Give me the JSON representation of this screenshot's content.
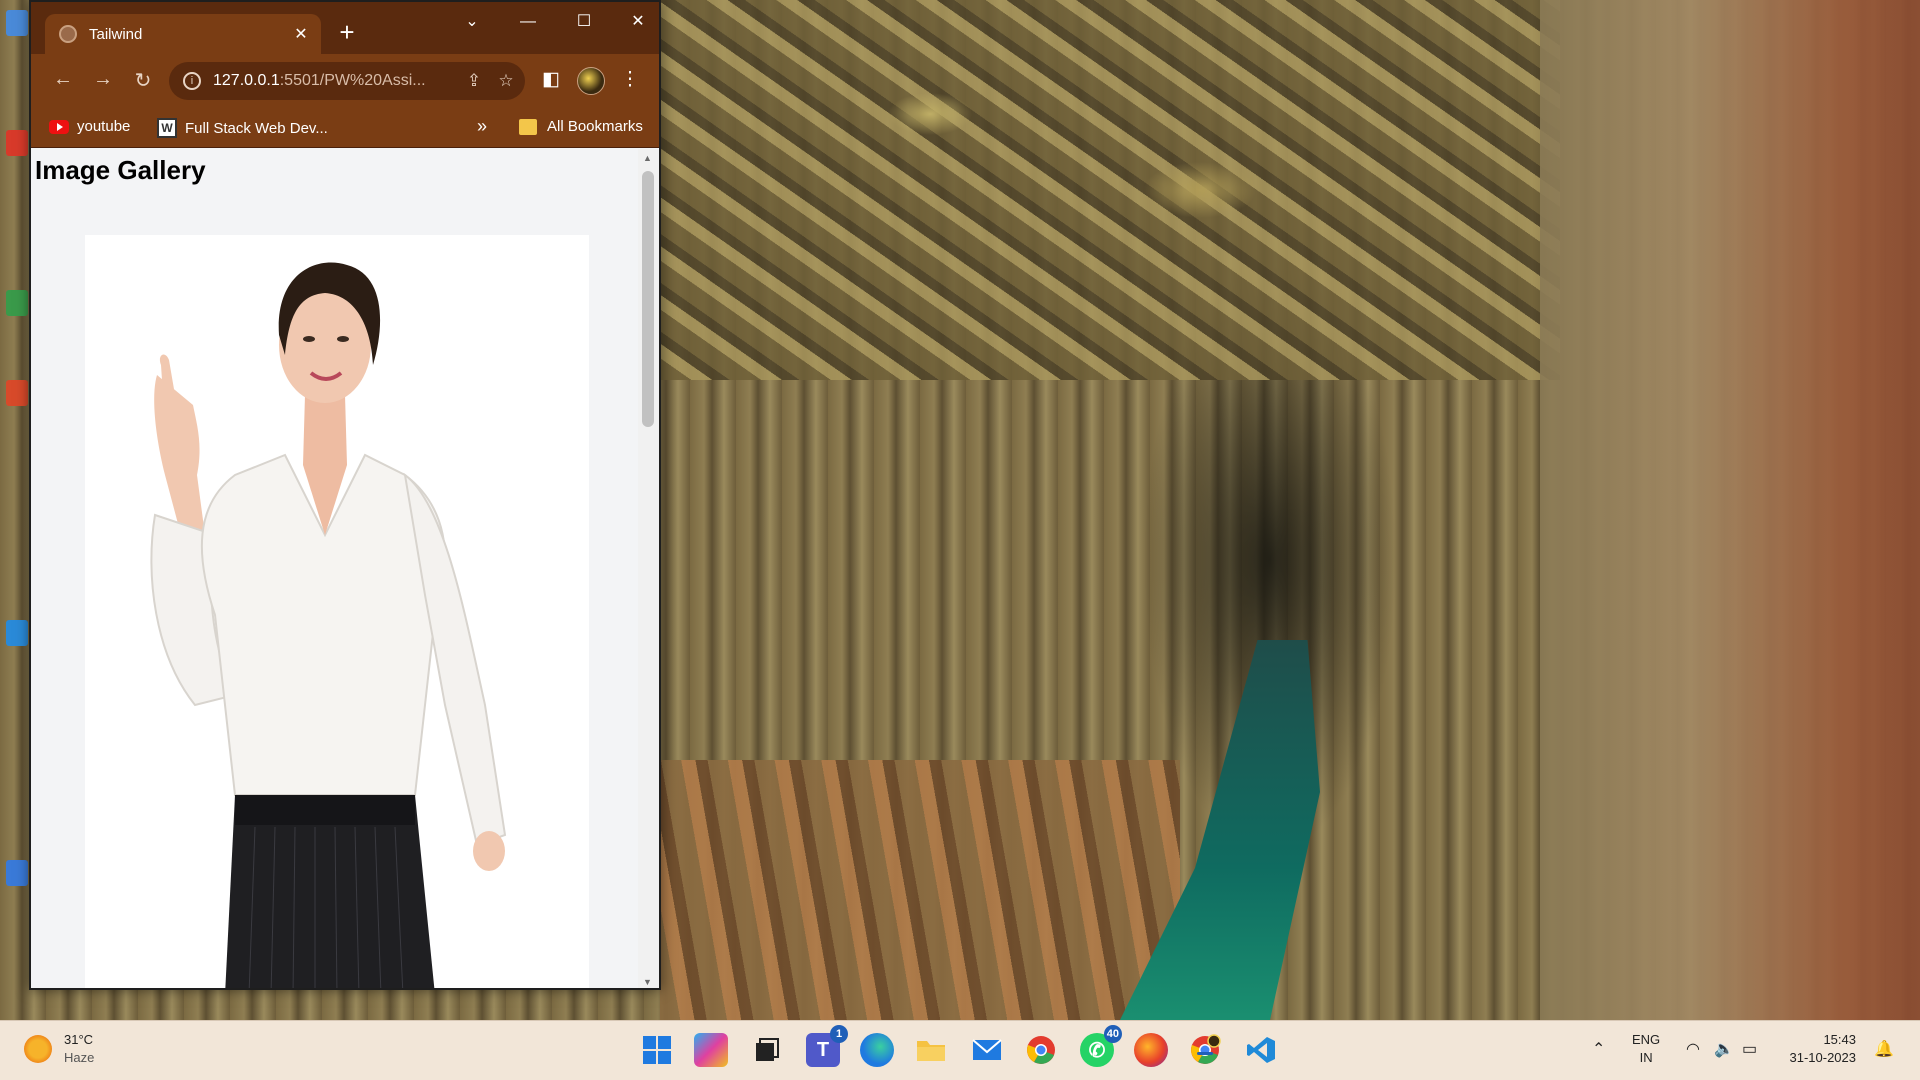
{
  "browser": {
    "tab_title": "Tailwind",
    "new_tab": "+",
    "window_controls": {
      "collapse": "⌄",
      "minimize": "—",
      "maximize": "☐",
      "close": "✕"
    },
    "url_host": "127.0.0.1",
    "url_rest": ":5501/PW%20Assi...",
    "bookmarks": [
      {
        "label": "youtube",
        "icon": "youtube-icon"
      },
      {
        "label": "Full Stack Web Dev...",
        "icon": "wordpress-icon"
      }
    ],
    "bookmarks_overflow": "»",
    "all_bookmarks": "All Bookmarks"
  },
  "page": {
    "heading": "Image Gallery",
    "image_alt": "Woman in white blouse pointing up"
  },
  "taskbar": {
    "weather": {
      "temp": "31°C",
      "condition": "Haze"
    },
    "apps": [
      {
        "name": "start",
        "icon": "windows-start-icon"
      },
      {
        "name": "copilot",
        "icon": "copilot-icon"
      },
      {
        "name": "task-view",
        "icon": "task-view-icon"
      },
      {
        "name": "teams",
        "icon": "teams-icon",
        "badge": "1"
      },
      {
        "name": "edge",
        "icon": "edge-icon"
      },
      {
        "name": "file-explorer",
        "icon": "folder-icon"
      },
      {
        "name": "mail",
        "icon": "mail-icon"
      },
      {
        "name": "chrome",
        "icon": "chrome-icon"
      },
      {
        "name": "whatsapp",
        "icon": "whatsapp-icon",
        "badge": "40"
      },
      {
        "name": "firefox",
        "icon": "firefox-icon"
      },
      {
        "name": "chrome-profile",
        "icon": "chrome-profile-icon"
      },
      {
        "name": "vscode",
        "icon": "vscode-icon"
      }
    ],
    "tray": {
      "language_top": "ENG",
      "language_bottom": "IN",
      "time": "15:43",
      "date": "31-10-2023"
    }
  },
  "colors": {
    "browser_frame": "#5a2a0e",
    "browser_toolbar": "#7a3d14",
    "page_bg": "#f3f4f6",
    "taskbar_bg": "#f2e6d8",
    "accent": "#1f5fb8"
  }
}
